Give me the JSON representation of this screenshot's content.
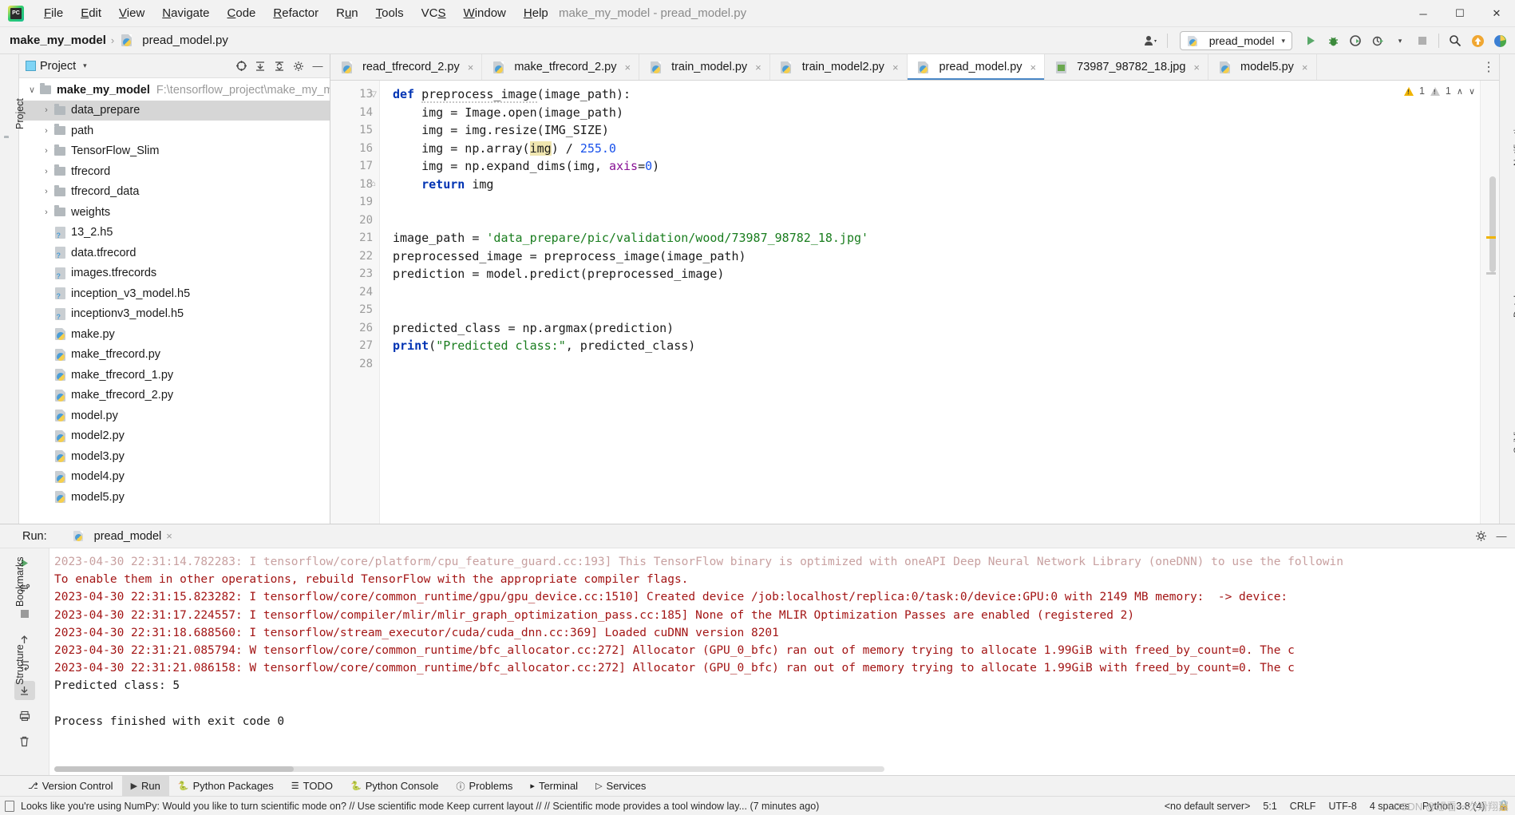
{
  "window": {
    "title": "make_my_model - pread_model.py",
    "app_icon": "pycharm-logo",
    "minimize": "─",
    "maximize": "☐",
    "close": "✕"
  },
  "menu": {
    "items": [
      {
        "label": "File"
      },
      {
        "label": "Edit"
      },
      {
        "label": "View"
      },
      {
        "label": "Navigate"
      },
      {
        "label": "Code"
      },
      {
        "label": "Refactor"
      },
      {
        "label": "Run"
      },
      {
        "label": "Tools"
      },
      {
        "label": "VCS"
      },
      {
        "label": "Window"
      },
      {
        "label": "Help"
      }
    ]
  },
  "breadcrumb": {
    "project": "make_my_model",
    "separator": "›",
    "file": "pread_model.py"
  },
  "toolbar": {
    "run_config": "pread_model",
    "run_icon": "run-play-icon",
    "debug_icon": "debug-bug-icon",
    "coverage_icon": "run-coverage-icon",
    "profile_icon": "run-profile-icon",
    "stop_icon": "stop-square-icon",
    "search_icon": "search-magnifier-icon",
    "update_icon": "update-arrow-icon",
    "account_icon": "account-person-icon"
  },
  "left_strip": {
    "project_label": "Project",
    "structure_label": "Structure",
    "bookmarks_label": "Bookmarks"
  },
  "project_panel": {
    "title": "Project",
    "caret": "▾",
    "actions": [
      "target-icon",
      "collapse-all-icon",
      "expand-icon",
      "gear-icon",
      "hide-icon"
    ],
    "root": {
      "name": "make_my_model",
      "path": "F:\\tensorflow_project\\make_my_mod",
      "arrow": "∨"
    },
    "nodes": [
      {
        "label": "data_prepare",
        "type": "folder",
        "arrow": "›",
        "selected": true
      },
      {
        "label": "path",
        "type": "folder",
        "arrow": "›",
        "selected": false
      },
      {
        "label": "TensorFlow_Slim",
        "type": "folder",
        "arrow": "›",
        "selected": false
      },
      {
        "label": "tfrecord",
        "type": "folder",
        "arrow": "›",
        "selected": false
      },
      {
        "label": "tfrecord_data",
        "type": "folder",
        "arrow": "›",
        "selected": false
      },
      {
        "label": "weights",
        "type": "folder",
        "arrow": "›",
        "selected": false
      },
      {
        "label": "13_2.h5",
        "type": "unknown",
        "arrow": "",
        "selected": false
      },
      {
        "label": "data.tfrecord",
        "type": "unknown",
        "arrow": "",
        "selected": false
      },
      {
        "label": "images.tfrecords",
        "type": "unknown",
        "arrow": "",
        "selected": false
      },
      {
        "label": "inception_v3_model.h5",
        "type": "unknown",
        "arrow": "",
        "selected": false
      },
      {
        "label": "inceptionv3_model.h5",
        "type": "unknown",
        "arrow": "",
        "selected": false
      },
      {
        "label": "make.py",
        "type": "python",
        "arrow": "",
        "selected": false
      },
      {
        "label": "make_tfrecord.py",
        "type": "python",
        "arrow": "",
        "selected": false
      },
      {
        "label": "make_tfrecord_1.py",
        "type": "python",
        "arrow": "",
        "selected": false
      },
      {
        "label": "make_tfrecord_2.py",
        "type": "python",
        "arrow": "",
        "selected": false
      },
      {
        "label": "model.py",
        "type": "python",
        "arrow": "",
        "selected": false
      },
      {
        "label": "model2.py",
        "type": "python",
        "arrow": "",
        "selected": false
      },
      {
        "label": "model3.py",
        "type": "python",
        "arrow": "",
        "selected": false
      },
      {
        "label": "model4.py",
        "type": "python",
        "arrow": "",
        "selected": false
      },
      {
        "label": "model5.py",
        "type": "python",
        "arrow": "",
        "selected": false
      }
    ]
  },
  "editor_tabs": {
    "tabs": [
      {
        "label": "read_tfrecord_2.py",
        "type": "python",
        "active": false
      },
      {
        "label": "make_tfrecord_2.py",
        "type": "python",
        "active": false
      },
      {
        "label": "train_model.py",
        "type": "python",
        "active": false
      },
      {
        "label": "train_model2.py",
        "type": "python",
        "active": false
      },
      {
        "label": "pread_model.py",
        "type": "python",
        "active": true
      },
      {
        "label": "73987_98782_18.jpg",
        "type": "image",
        "active": false
      },
      {
        "label": "model5.py",
        "type": "python",
        "active": false
      }
    ],
    "close_glyph": "×",
    "more_glyph": "⋮"
  },
  "inspections": {
    "warning_count": "1",
    "weak_warning_count": "1",
    "up_glyph": "∧",
    "down_glyph": "∨"
  },
  "editor": {
    "first_line": 13,
    "lines": [
      {
        "n": 13,
        "fold": "▽",
        "tokens": [
          {
            "t": "def ",
            "c": "kw"
          },
          {
            "t": "preprocess_image",
            "c": "wavy"
          },
          {
            "t": "(image_path):",
            "c": ""
          }
        ]
      },
      {
        "n": 14,
        "fold": "",
        "tokens": [
          {
            "t": "    img = Image.open(image_path)",
            "c": ""
          }
        ]
      },
      {
        "n": 15,
        "fold": "",
        "tokens": [
          {
            "t": "    img = img.resize(IMG_SIZE)",
            "c": ""
          }
        ]
      },
      {
        "n": 16,
        "fold": "",
        "tokens": [
          {
            "t": "    img = np.array(",
            "c": ""
          },
          {
            "t": "img",
            "c": "hl"
          },
          {
            "t": ") / ",
            "c": ""
          },
          {
            "t": "255.0",
            "c": "num"
          }
        ]
      },
      {
        "n": 17,
        "fold": "",
        "tokens": [
          {
            "t": "    img = np.expand_dims(img, ",
            "c": ""
          },
          {
            "t": "axis",
            "c": "par"
          },
          {
            "t": "=",
            "c": ""
          },
          {
            "t": "0",
            "c": "num"
          },
          {
            "t": ")",
            "c": ""
          }
        ]
      },
      {
        "n": 18,
        "fold": "⌂",
        "tokens": [
          {
            "t": "    ",
            "c": ""
          },
          {
            "t": "return",
            "c": "kw"
          },
          {
            "t": " img",
            "c": ""
          }
        ]
      },
      {
        "n": 19,
        "fold": "",
        "tokens": [
          {
            "t": "",
            "c": ""
          }
        ]
      },
      {
        "n": 20,
        "fold": "",
        "tokens": [
          {
            "t": "",
            "c": ""
          }
        ]
      },
      {
        "n": 21,
        "fold": "",
        "tokens": [
          {
            "t": "image_path = ",
            "c": ""
          },
          {
            "t": "'data_prepare/pic/validation/wood/73987_98782_18.jpg'",
            "c": "str"
          }
        ]
      },
      {
        "n": 22,
        "fold": "",
        "tokens": [
          {
            "t": "preprocessed_image = preprocess_image(image_path)",
            "c": ""
          }
        ]
      },
      {
        "n": 23,
        "fold": "",
        "tokens": [
          {
            "t": "prediction = model.predict(preprocessed_image)",
            "c": ""
          }
        ]
      },
      {
        "n": 24,
        "fold": "",
        "tokens": [
          {
            "t": "",
            "c": ""
          }
        ]
      },
      {
        "n": 25,
        "fold": "",
        "tokens": [
          {
            "t": "",
            "c": ""
          }
        ]
      },
      {
        "n": 26,
        "fold": "",
        "tokens": [
          {
            "t": "predicted_class = np.argmax(prediction)",
            "c": ""
          }
        ]
      },
      {
        "n": 27,
        "fold": "",
        "tokens": [
          {
            "t": "print",
            "c": "kw"
          },
          {
            "t": "(",
            "c": ""
          },
          {
            "t": "\"Predicted class:\"",
            "c": "str"
          },
          {
            "t": ", predicted_class)",
            "c": ""
          }
        ]
      },
      {
        "n": 28,
        "fold": "",
        "tokens": [
          {
            "t": "",
            "c": ""
          }
        ]
      }
    ]
  },
  "run_window": {
    "label": "Run:",
    "tab_name": "pread_model",
    "close_glyph": "×",
    "settings_icon": "gear-icon",
    "minimize_icon": "minimize-icon",
    "gutter_buttons": [
      {
        "name": "rerun-button",
        "glyph": "▶"
      },
      {
        "name": "settings-button",
        "glyph": "⚙"
      },
      {
        "name": "stop-button",
        "glyph": "■"
      },
      {
        "name": "scroll-up-button",
        "glyph": "↑"
      },
      {
        "name": "soft-wrap-button",
        "glyph": "↵"
      },
      {
        "name": "scroll-to-end-button",
        "glyph": "↧"
      },
      {
        "name": "print-button",
        "glyph": "⎙"
      },
      {
        "name": "clear-all-button",
        "glyph": "Ὕ1"
      }
    ],
    "output": [
      {
        "text": "2023-04-30 22:31:14.782283: I tensorflow/core/platform/cpu_feature_guard.cc:193] This TensorFlow binary is optimized with oneAPI Deep Neural Network Library (oneDNN) to use the followin",
        "style": "faded"
      },
      {
        "text": "To enable them in other operations, rebuild TensorFlow with the appropriate compiler flags.",
        "style": "red"
      },
      {
        "text": "2023-04-30 22:31:15.823282: I tensorflow/core/common_runtime/gpu/gpu_device.cc:1510] Created device /job:localhost/replica:0/task:0/device:GPU:0 with 2149 MB memory:  -> device:",
        "style": "red"
      },
      {
        "text": "2023-04-30 22:31:17.224557: I tensorflow/compiler/mlir/mlir_graph_optimization_pass.cc:185] None of the MLIR Optimization Passes are enabled (registered 2)",
        "style": "red"
      },
      {
        "text": "2023-04-30 22:31:18.688560: I tensorflow/stream_executor/cuda/cuda_dnn.cc:369] Loaded cuDNN version 8201",
        "style": "red"
      },
      {
        "text": "2023-04-30 22:31:21.085794: W tensorflow/core/common_runtime/bfc_allocator.cc:272] Allocator (GPU_0_bfc) ran out of memory trying to allocate 1.99GiB with freed_by_count=0. The c",
        "style": "red"
      },
      {
        "text": "2023-04-30 22:31:21.086158: W tensorflow/core/common_runtime/bfc_allocator.cc:272] Allocator (GPU_0_bfc) ran out of memory trying to allocate 1.99GiB with freed_by_count=0. The c",
        "style": "red"
      },
      {
        "text": "Predicted class: 5",
        "style": "black"
      },
      {
        "text": "",
        "style": "black"
      },
      {
        "text": "Process finished with exit code 0",
        "style": "black"
      }
    ]
  },
  "bottom_tools": {
    "items": [
      {
        "label": "Version Control",
        "icon": "branch-icon",
        "active": false
      },
      {
        "label": "Run",
        "icon": "run-play-icon",
        "active": true
      },
      {
        "label": "Python Packages",
        "icon": "python-icon",
        "active": false
      },
      {
        "label": "TODO",
        "icon": "todo-list-icon",
        "active": false
      },
      {
        "label": "Python Console",
        "icon": "python-console-icon",
        "active": false
      },
      {
        "label": "Problems",
        "icon": "problems-circle-icon",
        "active": false
      },
      {
        "label": "Terminal",
        "icon": "terminal-icon",
        "active": false
      },
      {
        "label": "Services",
        "icon": "services-icon",
        "active": false
      }
    ]
  },
  "status_bar": {
    "message": "Looks like you're using NumPy: Would you like to turn scientific mode on? // Use scientific mode  Keep current layout // // Scientific mode provides a tool window lay... (7 minutes ago)",
    "server": "<no default server>",
    "caret": "5:1",
    "line_sep": "CRLF",
    "encoding": "UTF-8",
    "indent": "4 spaces",
    "interpreter": "Python 3.8 (4)",
    "lock_icon": "lock-icon",
    "watermark": "CSDN @想看一次滑翔翼"
  }
}
